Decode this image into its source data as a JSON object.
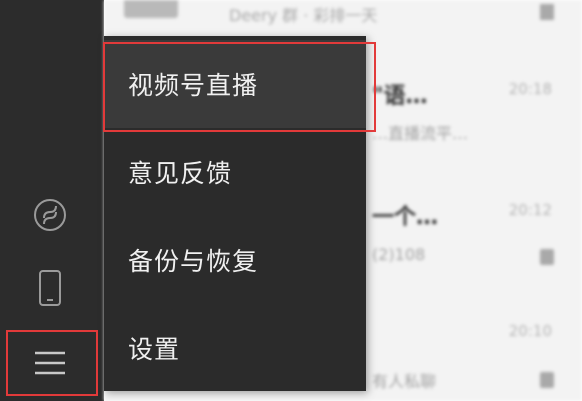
{
  "menu": {
    "items": [
      {
        "label": "视频号直播"
      },
      {
        "label": "意见反馈"
      },
      {
        "label": "备份与恢复"
      },
      {
        "label": "设置"
      }
    ]
  },
  "sidebar": {
    "icons": [
      "mini-programs-icon",
      "phone-icon",
      "hamburger-menu-icon"
    ]
  },
  "chat_list": {
    "top_strip": "Deery 群 · 彩排一天",
    "rows": [
      {
        "title": "\"语…",
        "sub": "…直播流平…",
        "time": "20:18"
      },
      {
        "title": "一个…",
        "sub": "(2)108",
        "time": "20:12"
      },
      {
        "title": "",
        "sub": "有人私聊",
        "time": "20:10"
      }
    ]
  },
  "colors": {
    "sidebar_bg": "#2c2c2c",
    "menu_bg": "#2b2b2b",
    "highlight_border": "#e23a3a"
  }
}
